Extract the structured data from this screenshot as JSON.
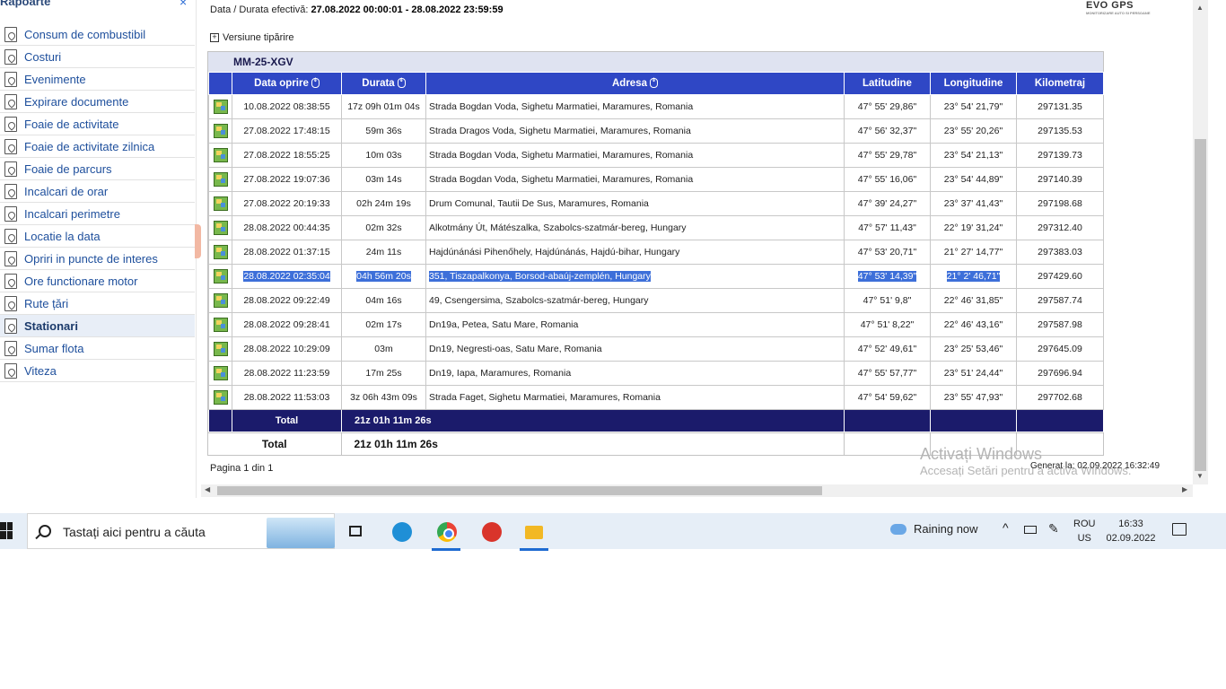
{
  "sidebar": {
    "title": "Rapoarte",
    "close_glyph": "×",
    "items": [
      {
        "label": "Consum de combustibil",
        "icon": "pdf-icon"
      },
      {
        "label": "Costuri",
        "icon": "pdf-icon"
      },
      {
        "label": "Evenimente",
        "icon": "pdf-icon"
      },
      {
        "label": "Expirare documente",
        "icon": "pdf-icon"
      },
      {
        "label": "Foaie de activitate",
        "icon": "pdf-icon"
      },
      {
        "label": "Foaie de activitate zilnica",
        "icon": "pdf-icon"
      },
      {
        "label": "Foaie de parcurs",
        "icon": "pdf-icon"
      },
      {
        "label": "Incalcari de orar",
        "icon": "pdf-icon"
      },
      {
        "label": "Incalcari perimetre",
        "icon": "pdf-icon"
      },
      {
        "label": "Locatie la data",
        "icon": "pdf-icon"
      },
      {
        "label": "Opriri in puncte de interes",
        "icon": "pdf-icon"
      },
      {
        "label": "Ore functionare motor",
        "icon": "pdf-icon"
      },
      {
        "label": "Rute țări",
        "icon": "pdf-icon"
      },
      {
        "label": "Stationari",
        "icon": "pdf-icon",
        "active": true
      },
      {
        "label": "Sumar flota",
        "icon": "pdf-icon"
      },
      {
        "label": "Viteza",
        "icon": "pdf-icon"
      }
    ]
  },
  "report": {
    "period_label": "Data / Durata efectivă:",
    "period_value": "27.08.2022 00:00:01 - 28.08.2022 23:59:59",
    "logo_text": "EVO GPS",
    "logo_subtitle": "MONITORIZARE AUTO SI PERSOANE",
    "print_toggle_glyph": "+",
    "print_toggle": "Versiune tipărire",
    "vehicle": "MM-25-XGV",
    "columns": [
      "Data oprire",
      "Durata",
      "Adresa",
      "Latitudine",
      "Longitudine",
      "Kilometraj"
    ],
    "rows": [
      [
        "10.08.2022 08:38:55",
        "17z 09h 01m 04s",
        "Strada Bogdan Voda,   Sighetu Marmatiei, Maramures, Romania",
        "47° 55' 29,86\"",
        "23° 54' 21,79\"",
        "297131.35"
      ],
      [
        "27.08.2022 17:48:15",
        "59m 36s",
        "Strada Dragos Voda,   Sighetu Marmatiei, Maramures, Romania",
        "47° 56' 32,37\"",
        "23° 55' 20,26\"",
        "297135.53"
      ],
      [
        "27.08.2022 18:55:25",
        "10m 03s",
        "Strada Bogdan Voda,   Sighetu Marmatiei, Maramures, Romania",
        "47° 55' 29,78\"",
        "23° 54' 21,13\"",
        "297139.73"
      ],
      [
        "27.08.2022 19:07:36",
        "03m 14s",
        "Strada Bogdan Voda,   Sighetu Marmatiei, Maramures, Romania",
        "47° 55' 16,06\"",
        "23° 54' 44,89\"",
        "297140.39"
      ],
      [
        "27.08.2022 20:19:33",
        "02h 24m 19s",
        "Drum Comunal,   Tautii De Sus, Maramures, Romania",
        "47° 39' 24,27\"",
        "23° 37' 41,43\"",
        "297198.68"
      ],
      [
        "28.08.2022 00:44:35",
        "02m 32s",
        "Alkotmány Út,   Mátészalka, Szabolcs-szatmár-bereg, Hungary",
        "47° 57' 11,43\"",
        "22° 19' 31,24\"",
        "297312.40"
      ],
      [
        "28.08.2022 01:37:15",
        "24m 11s",
        "Hajdúnánási Pihenőhely,   Hajdúnánás, Hajdú-bihar, Hungary",
        "47° 53' 20,71\"",
        "21° 27' 14,77\"",
        "297383.03"
      ],
      [
        "28.08.2022 02:35:04",
        "04h 56m 20s",
        "351,   Tiszapalkonya, Borsod-abaúj-zemplén, Hungary",
        "47° 53' 14,39\"",
        "21° 2' 46,71\"",
        "297429.60"
      ],
      [
        "28.08.2022 09:22:49",
        "04m 16s",
        "49,   Csengersima, Szabolcs-szatmár-bereg, Hungary",
        "47° 51' 9,8\"",
        "22° 46' 31,85\"",
        "297587.74"
      ],
      [
        "28.08.2022 09:28:41",
        "02m 17s",
        "Dn19a,   Petea, Satu Mare, Romania",
        "47° 51' 8,22\"",
        "22° 46' 43,16\"",
        "297587.98"
      ],
      [
        "28.08.2022 10:29:09",
        "03m",
        "Dn19,   Negresti-oas, Satu Mare, Romania",
        "47° 52' 49,61\"",
        "23° 25' 53,46\"",
        "297645.09"
      ],
      [
        "28.08.2022 11:23:59",
        "17m 25s",
        "Dn19,   Iapa, Maramures, Romania",
        "47° 55' 57,77\"",
        "23° 51' 24,44\"",
        "297696.94"
      ],
      [
        "28.08.2022 11:53:03",
        "3z 06h 43m 09s",
        "Strada Faget,   Sighetu Marmatiei, Maramures, Romania",
        "47° 54' 59,62\"",
        "23° 55' 47,93\"",
        "297702.68"
      ]
    ],
    "selected_row": 7,
    "total_label": "Total",
    "total_value": "21z 01h 11m 26s",
    "summary_label": "Total",
    "summary_value": "21z 01h 11m 26s",
    "pagination": "Pagina 1 din 1",
    "generated": "Generat la: 02.09.2022 16:32:49",
    "colors": {
      "header": "#2f47c5",
      "total": "#1b1b6b",
      "selection": "#3d6fd9"
    }
  },
  "watermark": {
    "line1": "Activați Windows",
    "line2": "Accesați Setări pentru a activa Windows."
  },
  "taskbar": {
    "search_placeholder": "Tastați aici pentru a căuta",
    "apps": [
      {
        "name": "task-view-icon"
      },
      {
        "name": "edge-icon",
        "color": "#1f8fd6"
      },
      {
        "name": "chrome-icon",
        "color": "#34a853",
        "active": true
      },
      {
        "name": "app-red-icon",
        "color": "#d9342b"
      },
      {
        "name": "file-explorer-icon",
        "color": "#f2b824",
        "active": true
      }
    ],
    "weather": "Raining now",
    "lang_line1": "ROU",
    "lang_line2": "US",
    "time": "16:33",
    "date": "02.09.2022"
  }
}
